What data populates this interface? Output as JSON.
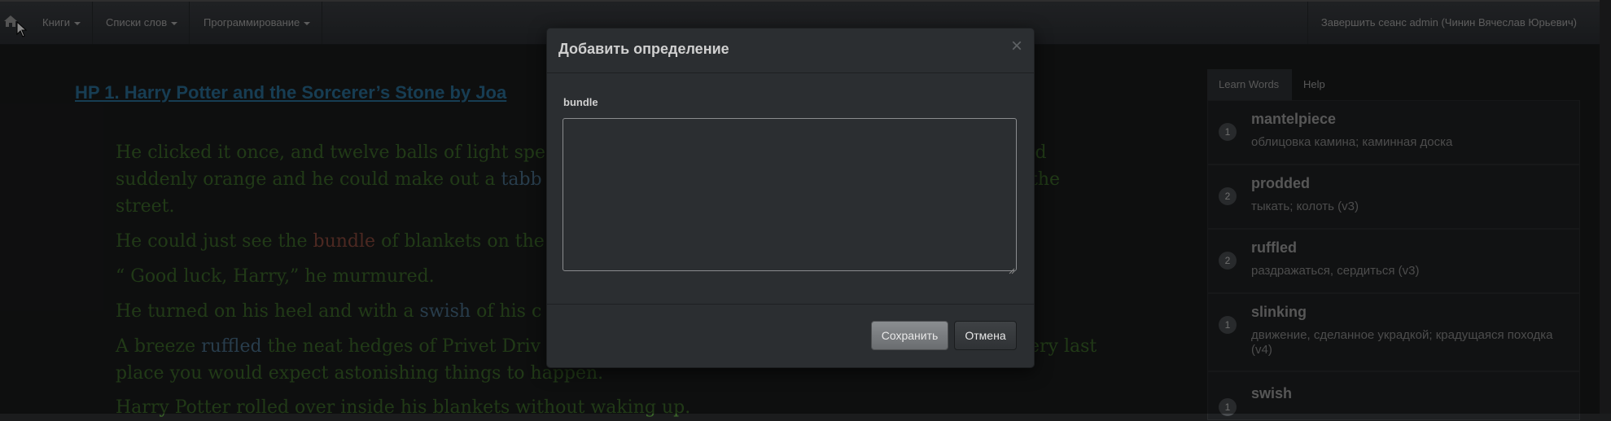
{
  "navbar": {
    "home_icon": "home-icon",
    "menu": [
      {
        "label": "Книги"
      },
      {
        "label": "Списки слов"
      },
      {
        "label": "Программирование"
      }
    ],
    "logout": "Завершить сеанс admin (Чинин Вячеслав Юрьевич)"
  },
  "book": {
    "title": "HP 1. Harry Potter and the Sorcerer’s Stone by Joa"
  },
  "text_lines": {
    "l1a": "He clicked it once, and twelve balls of light spe",
    "l1b": "ved",
    "l2a": "suddenly orange and he could make out a ",
    "l2w": "tabb",
    "l2b": "the",
    "l3": "street.",
    "l4a": "He could just see the ",
    "l4w": "bundle",
    "l4b": " of blankets on the",
    "l5": "“ Good luck, Harry,” he murmured.",
    "l6a": "He turned on his heel and with a ",
    "l6w": "swish",
    "l6b": " of his c",
    "l7a": "A breeze ",
    "l7w": "ruffled",
    "l7b": " the neat hedges of Privet Driv",
    "l7c": "ery last",
    "l8": "place you would expect astonishing things to happen.",
    "l9": "Harry Potter rolled over inside his blankets without waking up."
  },
  "sidebar": {
    "tabs": [
      {
        "label": "Learn Words"
      },
      {
        "label": "Help"
      }
    ],
    "words": [
      {
        "count": "1",
        "word": "mantelpiece",
        "definition": "облицовка камина; каминная доска"
      },
      {
        "count": "2",
        "word": "prodded",
        "definition": "тыкать; колоть (v3)"
      },
      {
        "count": "2",
        "word": "ruffled",
        "definition": "раздражаться, сердиться (v3)"
      },
      {
        "count": "1",
        "word": "slinking",
        "definition": "движение, сделанное украдкой; крадущаяся походка (v4)"
      },
      {
        "count": "1",
        "word": "swish",
        "definition": ""
      }
    ]
  },
  "modal": {
    "title": "Добавить определение",
    "close": "×",
    "word_label": "bundle",
    "textarea_value": "",
    "save_label": "Сохранить",
    "cancel_label": "Отмена"
  }
}
